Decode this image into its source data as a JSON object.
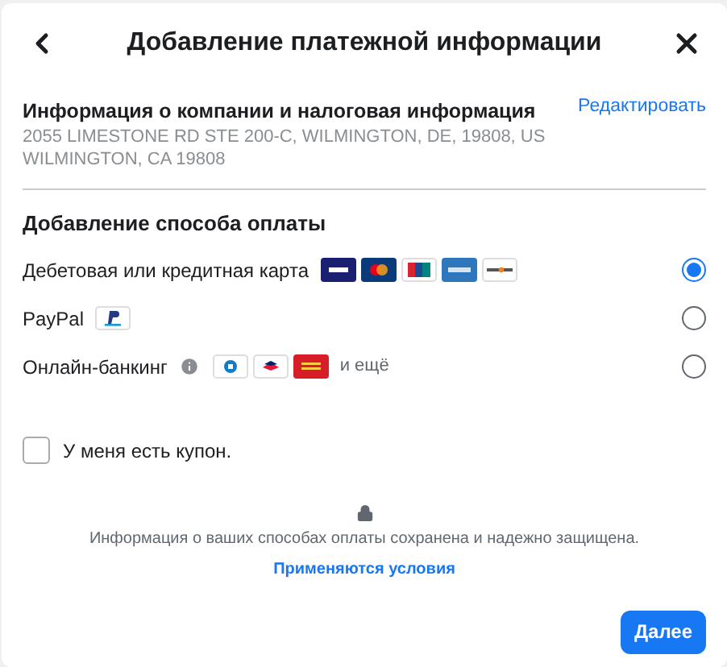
{
  "dialog": {
    "title": "Добавление платежной информации"
  },
  "company": {
    "heading": "Информация о компании и налоговая информация",
    "edit_link": "Редактировать",
    "address_lines": [
      "2055 LIMESTONE RD STE 200-C, WILMINGTON, DE, 19808, US",
      "WILMINGTON, CA 19808"
    ]
  },
  "payment": {
    "heading": "Добавление способа оплаты",
    "methods": [
      {
        "kind": "card",
        "label": "Дебетовая или кредитная карта",
        "selected": true
      },
      {
        "kind": "paypal",
        "label": "PayPal",
        "selected": false
      },
      {
        "kind": "bank",
        "label": "Онлайн-банкинг",
        "more": "и ещё",
        "selected": false
      }
    ]
  },
  "coupon": {
    "label": "У меня есть купон.",
    "checked": false
  },
  "security": {
    "note": "Информация о ваших способах оплаты сохранена и надежно защищена.",
    "terms_link": "Применяются условия"
  },
  "next_button": "Далее"
}
